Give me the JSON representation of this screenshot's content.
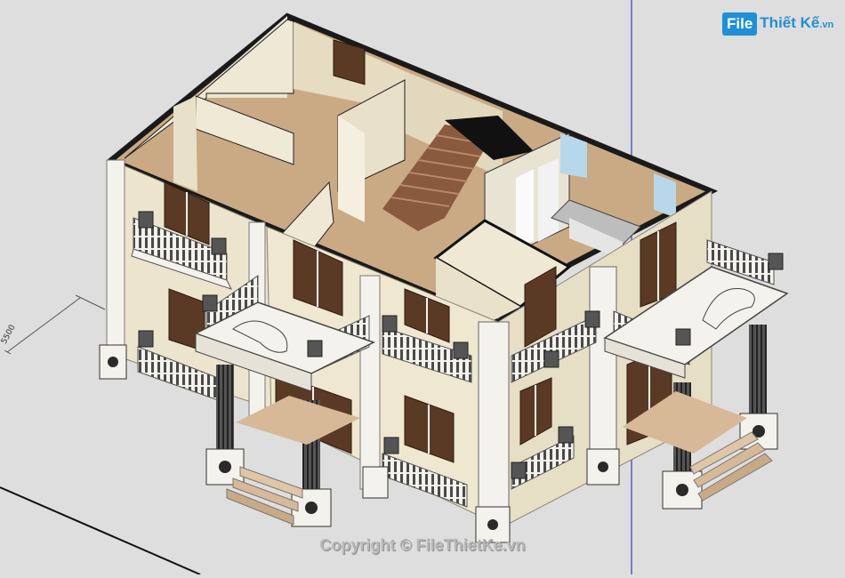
{
  "watermark": {
    "logo_box": "File",
    "logo_text": "Thiết Kế",
    "logo_tld": ".vn",
    "copyright": "Copyright © FileThietKe.vn"
  },
  "dimension": {
    "label": "5500"
  },
  "colors": {
    "background": "#dedede",
    "wall_face": "#ece4cd",
    "floor": "#c9aa85",
    "wall_top": "#1a1a1a",
    "trim": "#f4f2ec",
    "column": "#3d3d3d",
    "window": "#5a3a24",
    "axis_line": "#2a2ab8",
    "logo": "#1f8fd8"
  },
  "subject": {
    "icon": "house-3d-model-icon"
  }
}
